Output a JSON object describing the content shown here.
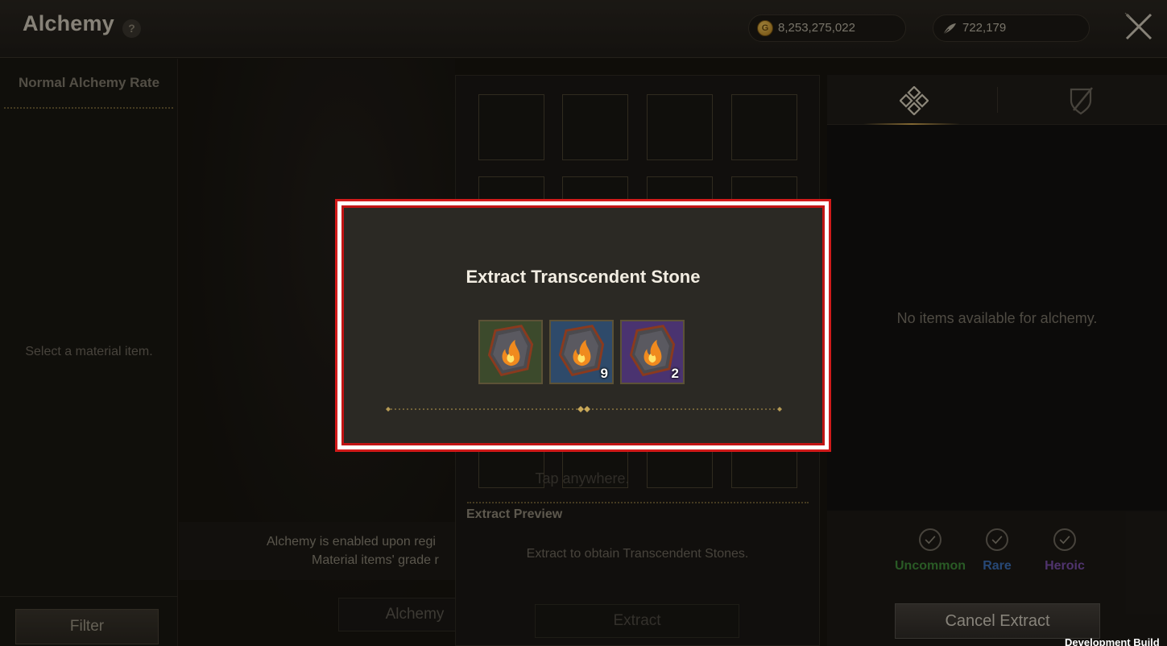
{
  "header": {
    "title": "Alchemy",
    "help_label": "?",
    "gold": "8,253,275,022",
    "gold_icon_letter": "G",
    "feathers": "722,179"
  },
  "left_panel": {
    "header": "Normal Alchemy Rate",
    "placeholder": "Select a material item.",
    "filter_label": "Filter"
  },
  "middle": {
    "info_line1": "Alchemy is enabled upon regi",
    "info_line2": "Material items' grade r",
    "alchemy_label": "Alchemy"
  },
  "center": {
    "tap_hint": "Tap anywhere.",
    "preview_title": "Extract Preview",
    "preview_desc": "Extract to obtain Transcendent Stones.",
    "extract_label": "Extract"
  },
  "right_panel": {
    "tabs": [
      {
        "name": "material-tab",
        "icon": "diamond-pattern-icon"
      },
      {
        "name": "weapon-tab",
        "icon": "shield-sword-icon"
      }
    ],
    "empty_text": "No items available for alchemy.",
    "grades": [
      {
        "label": "Uncommon",
        "color": "#3f8a3a"
      },
      {
        "label": "Rare",
        "color": "#3d6fb5"
      },
      {
        "label": "Heroic",
        "color": "#7a4fa8"
      }
    ],
    "cancel_label": "Cancel Extract"
  },
  "modal": {
    "title": "Extract Transcendent Stone",
    "stones": [
      {
        "grade": "uncommon",
        "bg": "#3c4a2c",
        "qty": ""
      },
      {
        "grade": "rare",
        "bg": "#2e4a6a",
        "qty": "9"
      },
      {
        "grade": "heroic",
        "bg": "#4a3370",
        "qty": "2"
      }
    ]
  },
  "footer": {
    "dev_build": "Development Build"
  }
}
